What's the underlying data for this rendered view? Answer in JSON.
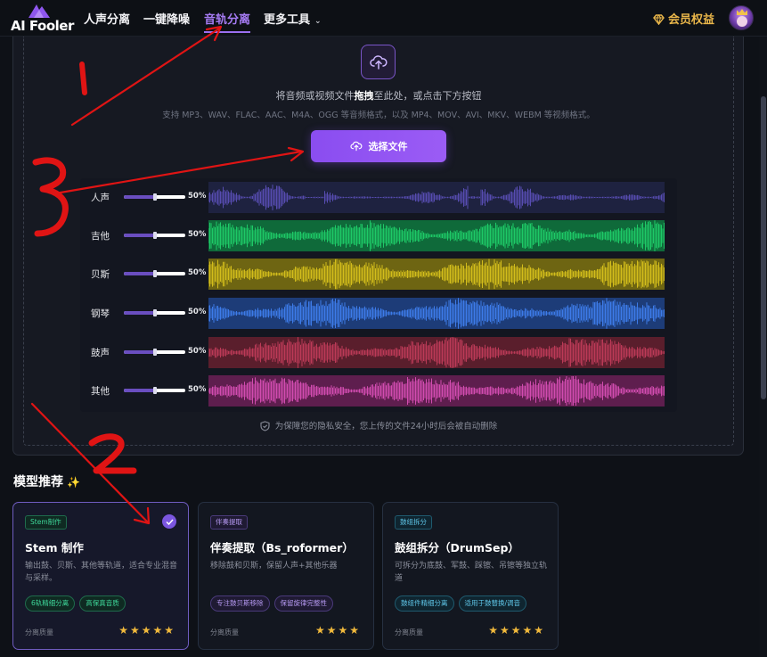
{
  "nav": {
    "logo_text": "AI Fooler",
    "links": [
      {
        "label": "人声分离",
        "active": false
      },
      {
        "label": "一键降噪",
        "active": false
      },
      {
        "label": "音轨分离",
        "active": true
      },
      {
        "label": "更多工具",
        "active": false
      }
    ],
    "member_label": "会员权益"
  },
  "upload": {
    "main_text_pre": "将音频或视频文件",
    "main_text_bold": "拖拽",
    "main_text_post": "至此处，或点击下方按钮",
    "sub_text": "支持 MP3、WAV、FLAC、AAC、M4A、OGG 等音频格式，以及 MP4、MOV、AVI、MKV、WEBM 等视频格式。",
    "button_label": "选择文件"
  },
  "tracks": [
    {
      "name": "人声",
      "volume": "50%",
      "volume_fraction": 0.5,
      "color": "#5b4fb8",
      "bg": "#1e2240"
    },
    {
      "name": "吉他",
      "volume": "50%",
      "volume_fraction": 0.5,
      "color": "#1fcf6a",
      "bg": "#0f6a3a"
    },
    {
      "name": "贝斯",
      "volume": "50%",
      "volume_fraction": 0.5,
      "color": "#d9c21c",
      "bg": "#6e6512"
    },
    {
      "name": "钢琴",
      "volume": "50%",
      "volume_fraction": 0.5,
      "color": "#3f7ff0",
      "bg": "#1d3c78"
    },
    {
      "name": "鼓声",
      "volume": "50%",
      "volume_fraction": 0.5,
      "color": "#c23c5a",
      "bg": "#5a1e2c"
    },
    {
      "name": "其他",
      "volume": "50%",
      "volume_fraction": 0.5,
      "color": "#d94fb6",
      "bg": "#5e1e4e"
    }
  ],
  "privacy_text": "为保障您的隐私安全，您上传的文件24小时后会被自动删除",
  "models": {
    "section_title": "模型推荐",
    "cards": [
      {
        "tag": "Stem制作",
        "title": "Stem 制作",
        "desc": "输出鼓、贝斯、其他等轨道，适合专业混音与采样。",
        "chips": [
          "6轨精细分离",
          "高保真音质"
        ],
        "quality_label": "分离质量",
        "stars": "★★★★★",
        "selected": true
      },
      {
        "tag": "伴奏提取",
        "title": "伴奏提取（Bs_roformer）",
        "desc": "移除鼓和贝斯，保留人声+其他乐器",
        "chips": [
          "专注鼓贝斯移除",
          "保留旋律完整性"
        ],
        "quality_label": "分离质量",
        "stars": "★★★★",
        "selected": false
      },
      {
        "tag": "鼓组拆分",
        "title": "鼓组拆分（DrumSep）",
        "desc": "可拆分为底鼓、军鼓、踩镲、吊镲等独立轨道",
        "chips": [
          "鼓组件精细分离",
          "适用于鼓替换/调音"
        ],
        "quality_label": "分离质量",
        "stars": "★★★★★",
        "selected": false
      }
    ]
  },
  "annotations": {
    "color": "#e01414",
    "marks": [
      "1",
      "3",
      "2"
    ]
  },
  "colors": {
    "accent": "#8a4df0",
    "member_gold": "#e9b64a"
  }
}
